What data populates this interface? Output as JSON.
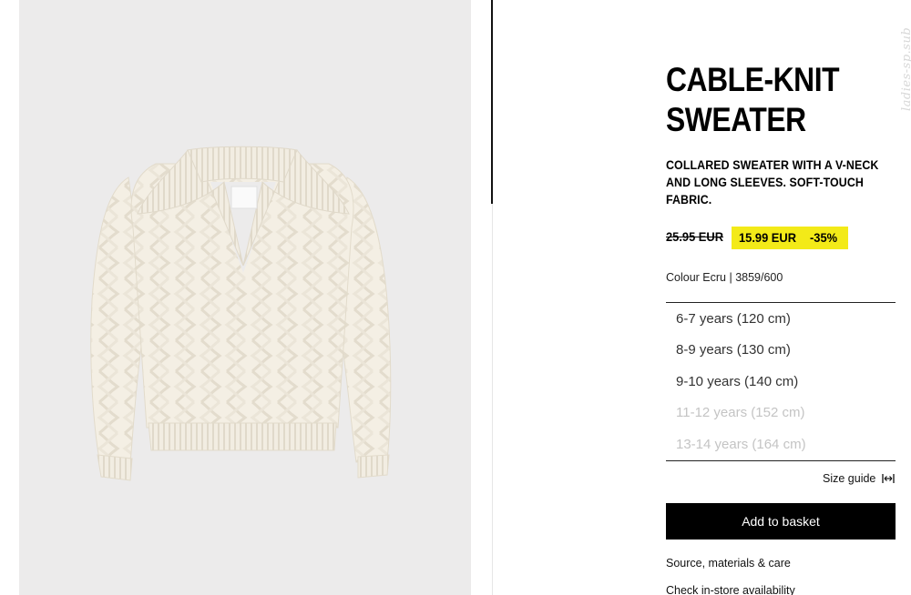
{
  "product": {
    "title_lines": [
      "CABLE-KNIT",
      "SWEATER"
    ],
    "description": "COLLARED SWEATER WITH A V-NECK AND LONG SLEEVES. SOFT-TOUCH FABRIC.",
    "old_price": "25.95 EUR",
    "sale_price": "15.99 EUR",
    "discount": "-35%",
    "colour_info": "Colour Ecru | 3859/600",
    "image_alt": "Ecru cable-knit collared sweater"
  },
  "sizes": [
    {
      "label": "6-7 years (120 cm)",
      "available": true
    },
    {
      "label": "8-9 years (130 cm)",
      "available": true
    },
    {
      "label": "9-10 years (140 cm)",
      "available": true
    },
    {
      "label": "11-12 years (152 cm)",
      "available": false
    },
    {
      "label": "13-14 years (164 cm)",
      "available": false
    }
  ],
  "actions": {
    "size_guide": "Size guide",
    "add_to_basket": "Add to basket",
    "materials": "Source, materials & care",
    "availability": "Check in-store availability"
  },
  "watermark": "ladies-sp.sub",
  "colors": {
    "sale_highlight": "#f3ea18",
    "photo_background": "#ecebeb",
    "button": "#000000",
    "unavailable_text": "#c4c4c4"
  },
  "icons": {
    "size_guide": "ruler-arrows-icon"
  }
}
